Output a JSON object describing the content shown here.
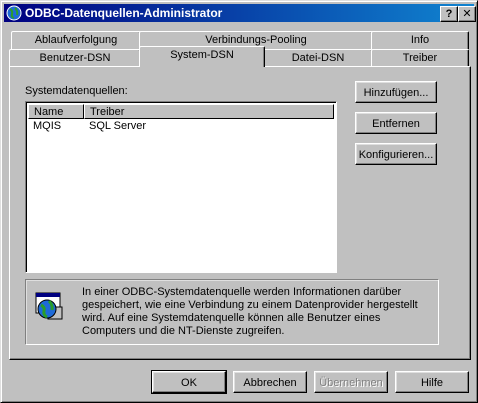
{
  "window": {
    "title": "ODBC-Datenquellen-Administrator",
    "help_btn": "?",
    "close_btn": "✕"
  },
  "tabs_back": [
    {
      "label": "Ablaufverfolgung"
    },
    {
      "label": "Verbindungs-Pooling"
    },
    {
      "label": "Info"
    }
  ],
  "tabs_front": [
    {
      "label": "Benutzer-DSN"
    },
    {
      "label": "System-DSN"
    },
    {
      "label": "Datei-DSN"
    },
    {
      "label": "Treiber"
    }
  ],
  "active_tab": "System-DSN",
  "panel": {
    "list_label": "Systemdatenquellen:",
    "columns": [
      "Name",
      "Treiber"
    ],
    "rows": [
      {
        "name": "MQIS",
        "driver": "SQL Server"
      }
    ],
    "buttons": {
      "add": "Hinzufügen...",
      "remove": "Entfernen",
      "configure": "Konfigurieren..."
    },
    "info_text": "In einer ODBC-Systemdatenquelle werden Informationen darüber gespeichert, wie eine Verbindung zu einem Datenprovider hergestellt wird. Auf eine Systemdatenquelle können alle Benutzer eines Computers und die NT-Dienste zugreifen."
  },
  "footer": {
    "ok": "OK",
    "cancel": "Abbrechen",
    "apply": "Übernehmen",
    "help": "Hilfe"
  },
  "colors": {
    "titlebar_start": "#000080",
    "titlebar_end": "#1084d0",
    "face": "#c0c0c0"
  }
}
